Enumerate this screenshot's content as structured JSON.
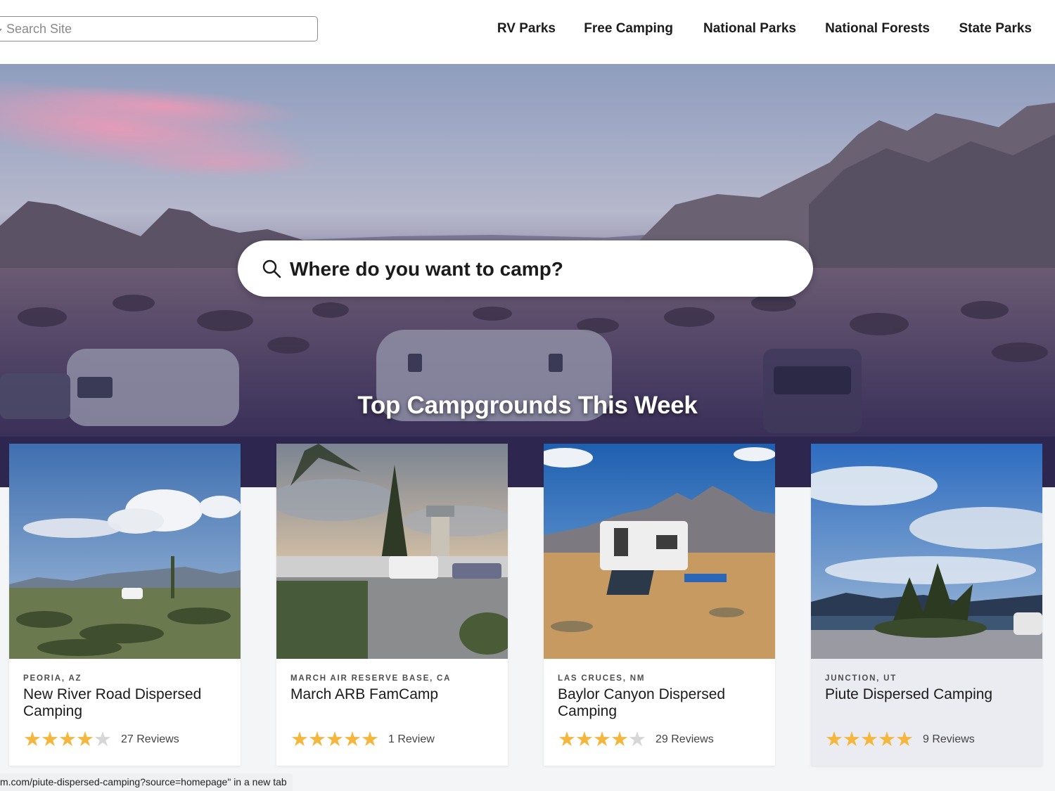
{
  "header": {
    "search_placeholder": "Search Site",
    "nav": [
      {
        "label": "RV Parks"
      },
      {
        "label": "Free Camping"
      },
      {
        "label": "National Parks"
      },
      {
        "label": "National Forests"
      },
      {
        "label": "State Parks"
      }
    ]
  },
  "hero": {
    "search_placeholder": "Where do you want to camp?",
    "section_title": "Top Campgrounds This Week"
  },
  "cards": [
    {
      "location": "PEORIA, AZ",
      "name": "New River Road Dispersed Camping",
      "stars": 4,
      "reviews": "27 Reviews"
    },
    {
      "location": "MARCH AIR RESERVE BASE, CA",
      "name": "March ARB FamCamp",
      "stars": 5,
      "reviews": "1 Review"
    },
    {
      "location": "LAS CRUCES, NM",
      "name": "Baylor Canyon Dispersed Camping",
      "stars": 4,
      "reviews": "29 Reviews"
    },
    {
      "location": "JUNCTION, UT",
      "name": "Piute Dispersed Camping",
      "stars": 5,
      "reviews": "9 Reviews"
    }
  ],
  "status_bar": {
    "text": "m.com/piute-dispersed-camping?source=homepage\" in a new tab"
  },
  "colors": {
    "star": "#f4b63c",
    "star_empty": "#d6d6d6",
    "hover_card": "#ebecf1",
    "hero_dark": "#2d2750"
  }
}
